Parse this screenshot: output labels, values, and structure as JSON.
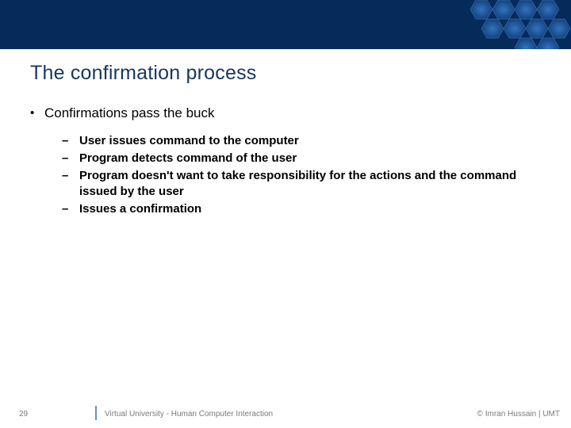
{
  "header": {
    "title": "The confirmation process"
  },
  "body": {
    "bullet": {
      "mark": "•",
      "text": "Confirmations pass the buck"
    },
    "subitems": [
      {
        "mark": "–",
        "text": "User issues command to the computer"
      },
      {
        "mark": "–",
        "text": "Program detects command of the user"
      },
      {
        "mark": "–",
        "text": "Program doesn't want to take responsibility for the actions and the command issued by the user"
      },
      {
        "mark": "–",
        "text": "Issues a confirmation"
      }
    ]
  },
  "footer": {
    "page": "29",
    "center": "Virtual University - Human Computer Interaction",
    "right": "© Imran Hussain | UMT"
  },
  "decor": {
    "hex_fill": "#1f63b7",
    "hex_stroke": "#3e7fcf"
  }
}
